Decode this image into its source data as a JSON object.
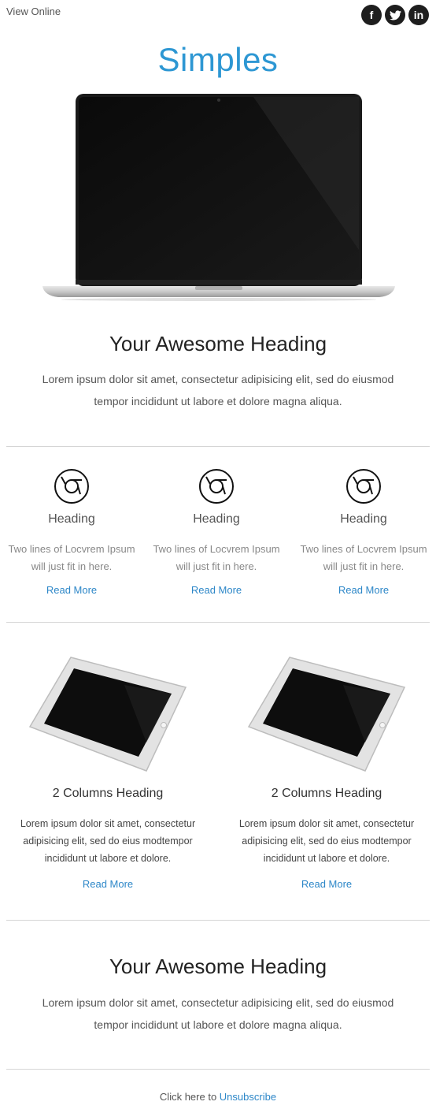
{
  "topbar": {
    "view_online": "View Online",
    "social": [
      {
        "icon": "facebook-icon",
        "glyph": "f"
      },
      {
        "icon": "twitter-icon",
        "glyph": "t"
      },
      {
        "icon": "linkedin-icon",
        "glyph": "in"
      }
    ]
  },
  "brand": "Simples",
  "hero": {
    "heading": "Your Awesome Heading",
    "text": "Lorem ipsum dolor sit amet, consectetur adipisicing elit, sed do eiusmod tempor incididunt ut labore et dolore magna aliqua."
  },
  "three_col": [
    {
      "icon": "chrome-icon",
      "heading": "Heading",
      "text": "Two lines of Locvrem Ipsum will just fit in here.",
      "link": "Read More"
    },
    {
      "icon": "chrome-icon",
      "heading": "Heading",
      "text": "Two lines of Locvrem Ipsum will just fit in here.",
      "link": "Read More"
    },
    {
      "icon": "chrome-icon",
      "heading": "Heading",
      "text": "Two lines of Locvrem Ipsum will just fit in here.",
      "link": "Read More"
    }
  ],
  "two_col": [
    {
      "heading": "2 Columns Heading",
      "text": "Lorem ipsum dolor sit amet, consectetur adipisicing elit, sed do eius modtempor incididunt ut labore et dolore.",
      "link": "Read More"
    },
    {
      "heading": "2 Columns Heading",
      "text": "Lorem ipsum dolor sit amet, consectetur adipisicing elit, sed do eius modtempor incididunt ut labore et dolore.",
      "link": "Read More"
    }
  ],
  "bottom": {
    "heading": "Your Awesome Heading",
    "text": "Lorem ipsum dolor sit amet, consectetur adipisicing elit, sed do eiusmod tempor incididunt ut labore et dolore magna aliqua."
  },
  "footer": {
    "prefix": "Click here to",
    "link": "Unsubscribe"
  },
  "colors": {
    "accent": "#2d97d3",
    "link": "#2d87c8",
    "divider": "#d5d5d5"
  }
}
